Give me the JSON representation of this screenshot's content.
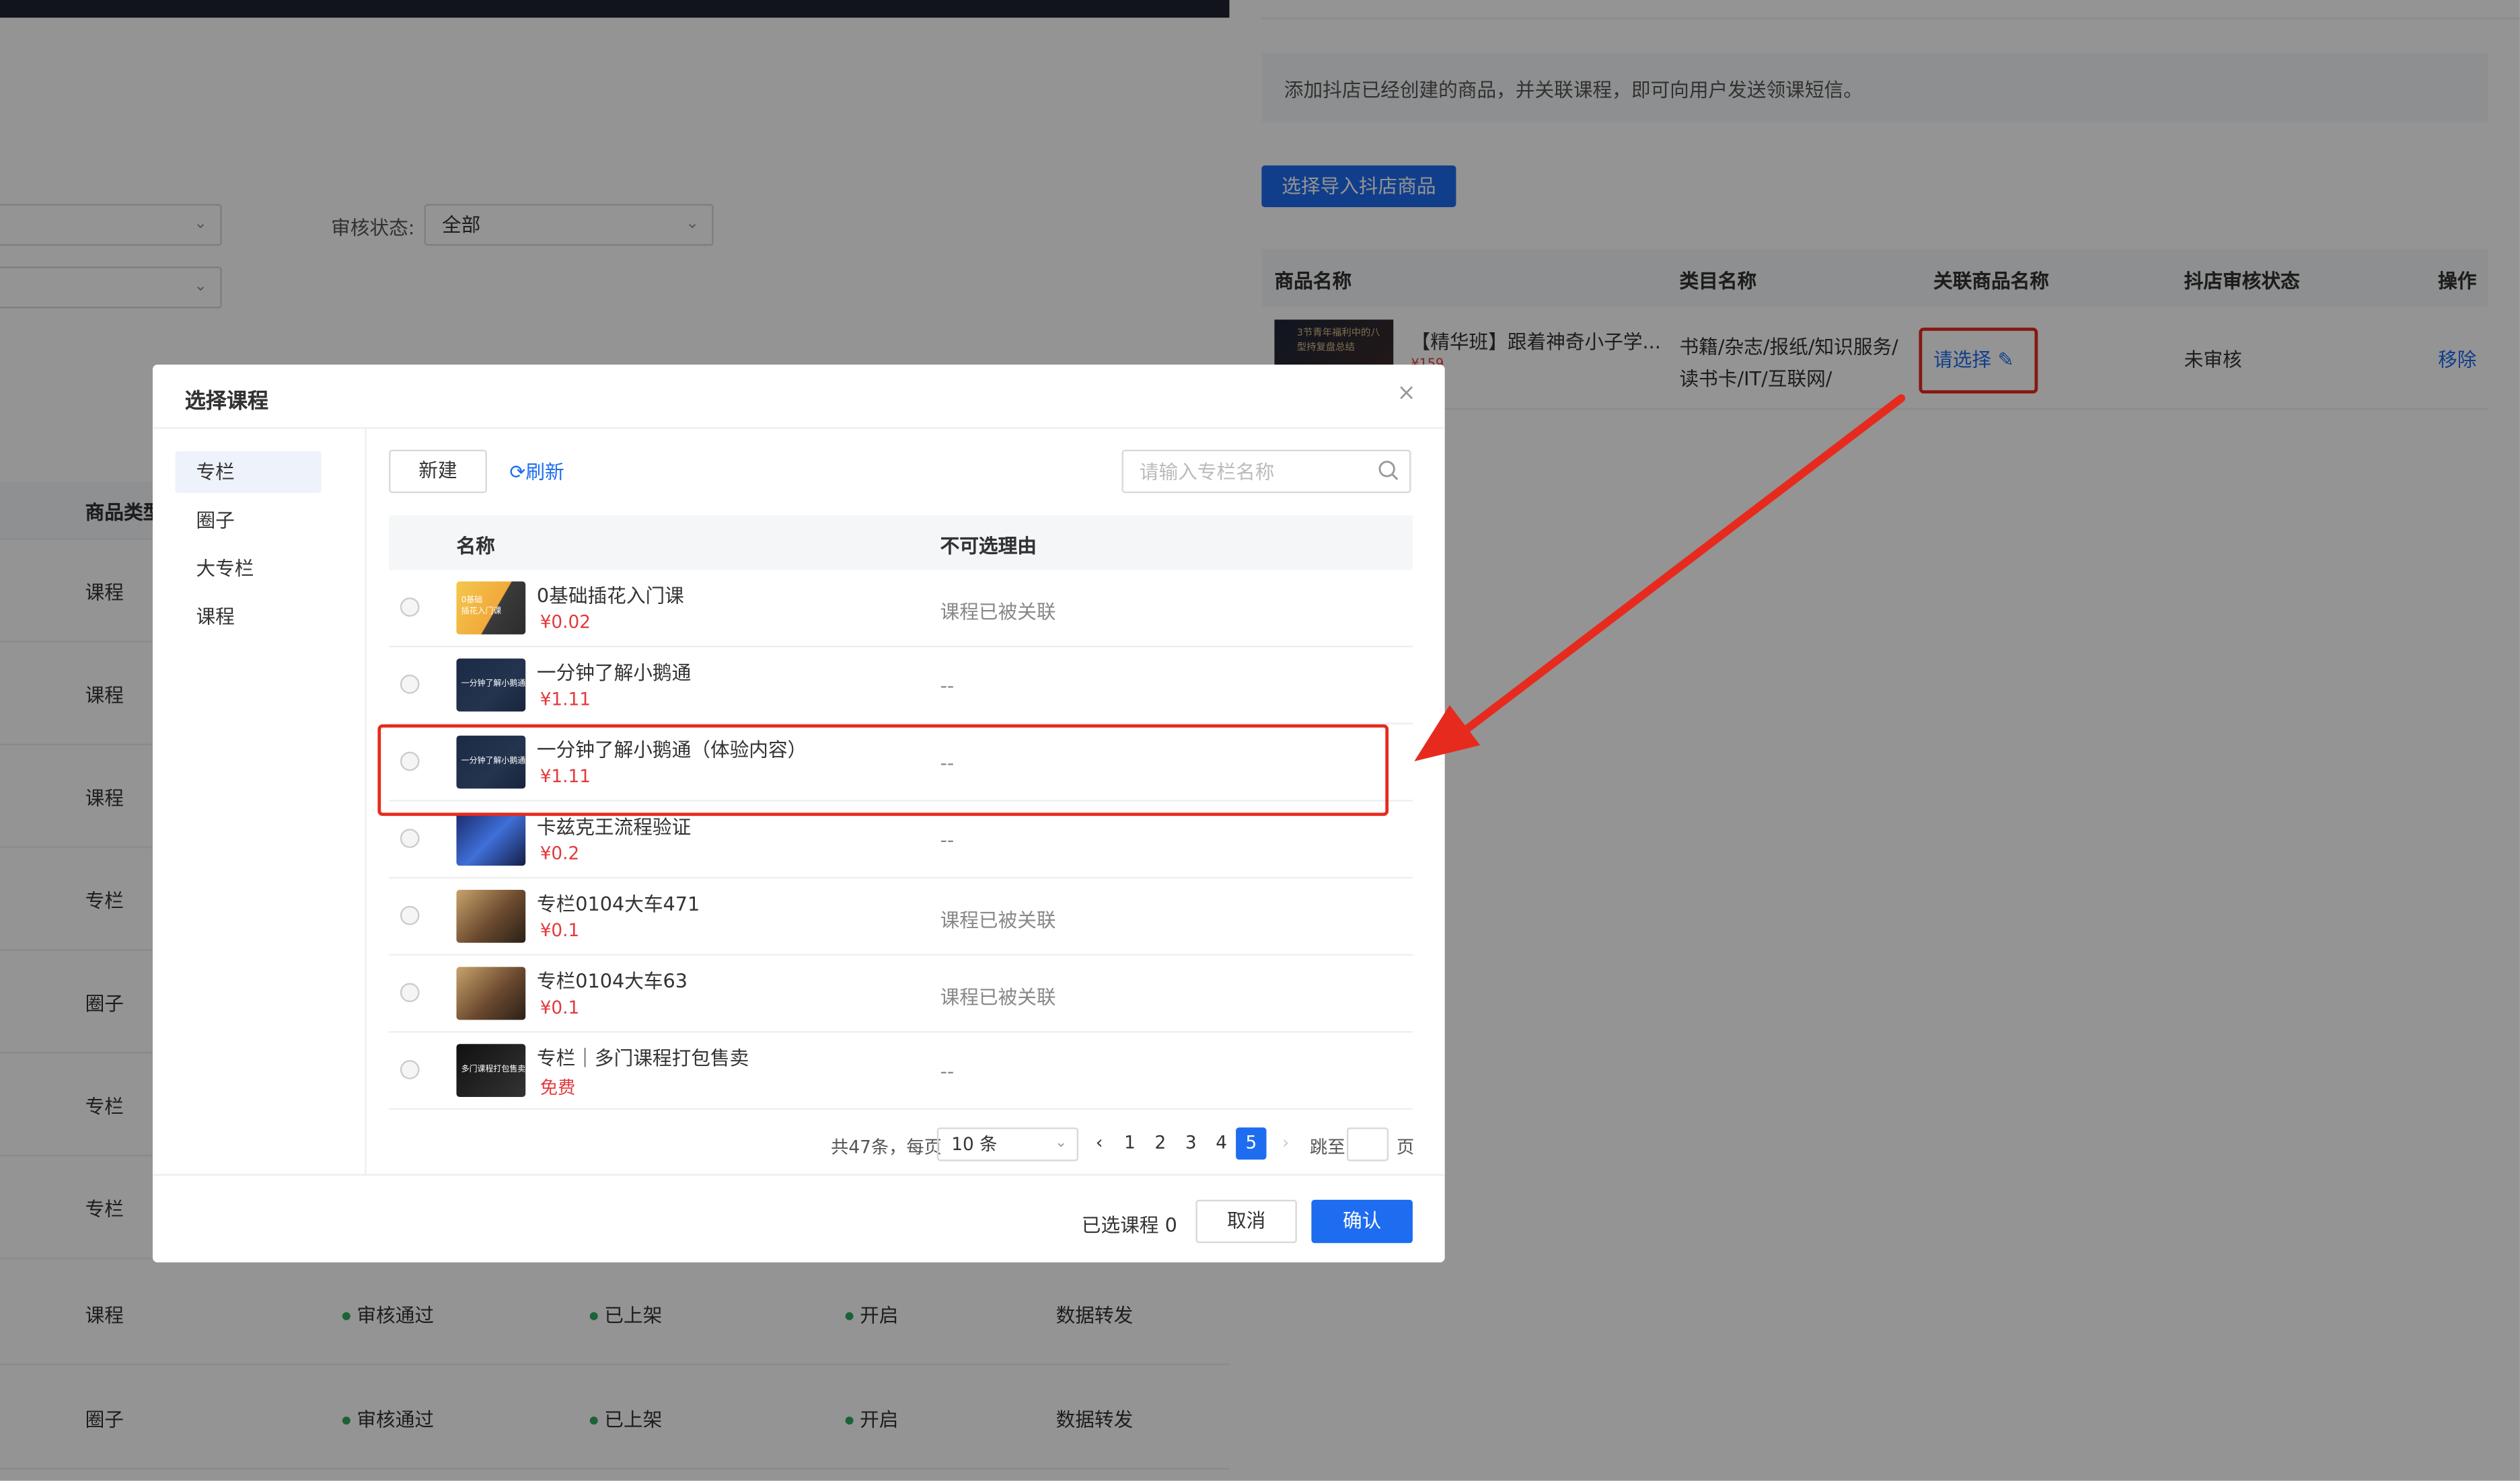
{
  "background_page": {
    "filters": {
      "status_label": "审核状态:",
      "status_value": "全部"
    },
    "table": {
      "first_column_header": "商品类型",
      "rows": [
        {
          "type": "课程"
        },
        {
          "type": "课程"
        },
        {
          "type": "课程"
        },
        {
          "type": "专栏"
        },
        {
          "type": "圈子"
        },
        {
          "type": "专栏"
        },
        {
          "type": "专栏"
        },
        {
          "type": "课程",
          "audit": "审核通过",
          "shelf": "已上架",
          "switch": "开启",
          "data": "数据转发"
        },
        {
          "type": "圈子",
          "audit": "审核通过",
          "shelf": "已上架",
          "switch": "开启",
          "data": "数据转发"
        }
      ]
    }
  },
  "drawer": {
    "tip": "添加抖店已经创建的商品，并关联课程，即可向用户发送领课短信。",
    "import_button": "选择导入抖店商品",
    "columns": [
      "商品名称",
      "类目名称",
      "关联商品名称",
      "抖店审核状态",
      "操作"
    ],
    "row": {
      "thumb_text": "3节青年福利中的八\n型持复盘总结",
      "name": "【精华班】跟着神奇小子学...",
      "price": "¥159",
      "category": "书籍/杂志/报纸/知识服务/读书卡/IT/互联网/",
      "select_label": "请选择",
      "select_icon": "edit-pen",
      "audit_status": "未审核",
      "action": "移除"
    }
  },
  "modal": {
    "title": "选择课程",
    "close_glyph": "×",
    "sidebar": [
      "专栏",
      "圈子",
      "大专栏",
      "课程"
    ],
    "new_button": "新建",
    "refresh_label": "刷新",
    "search_placeholder": "请输入专栏名称",
    "columns": {
      "name": "名称",
      "reason": "不可选理由"
    },
    "courses": [
      {
        "name": "0基础插花入门课",
        "price": "¥0.02",
        "reason": "课程已被关联",
        "thumb": "flower",
        "thumb_text": "0基础\n插花入门课"
      },
      {
        "name": "一分钟了解小鹅通",
        "price": "¥1.11",
        "reason": "--",
        "thumb": "dark",
        "thumb_text": "一分钟了解小鹅通"
      },
      {
        "name": "一分钟了解小鹅通（体验内容）",
        "price": "¥1.11",
        "reason": "--",
        "thumb": "dark",
        "thumb_text": "一分钟了解小鹅通"
      },
      {
        "name": "卡兹克王流程验证",
        "price": "¥0.2",
        "reason": "--",
        "thumb": "hero",
        "thumb_text": ""
      },
      {
        "name": "专栏0104大车471",
        "price": "¥0.1",
        "reason": "课程已被关联",
        "thumb": "art",
        "thumb_text": ""
      },
      {
        "name": "专栏0104大车63",
        "price": "¥0.1",
        "reason": "课程已被关联",
        "thumb": "art",
        "thumb_text": ""
      },
      {
        "name": "专栏｜多门课程打包售卖",
        "price": "免费",
        "reason": "--",
        "thumb": "black",
        "thumb_text": "多门课程打包售卖"
      }
    ],
    "pagination": {
      "total": "共47条，每页",
      "page_size": "10 条",
      "prev": "‹",
      "pages": [
        "1",
        "2",
        "3",
        "4",
        "5"
      ],
      "current_page": "5",
      "next": "›",
      "jump_label": "跳至",
      "page_word": "页"
    },
    "footer": {
      "selected": "已选课程 0",
      "cancel": "取消",
      "confirm": "确认"
    }
  },
  "colors": {
    "primary": "#1e6cf0",
    "price_red": "#e4393c",
    "annotation_red": "#e62b1e",
    "status_green": "#2faa5f"
  }
}
